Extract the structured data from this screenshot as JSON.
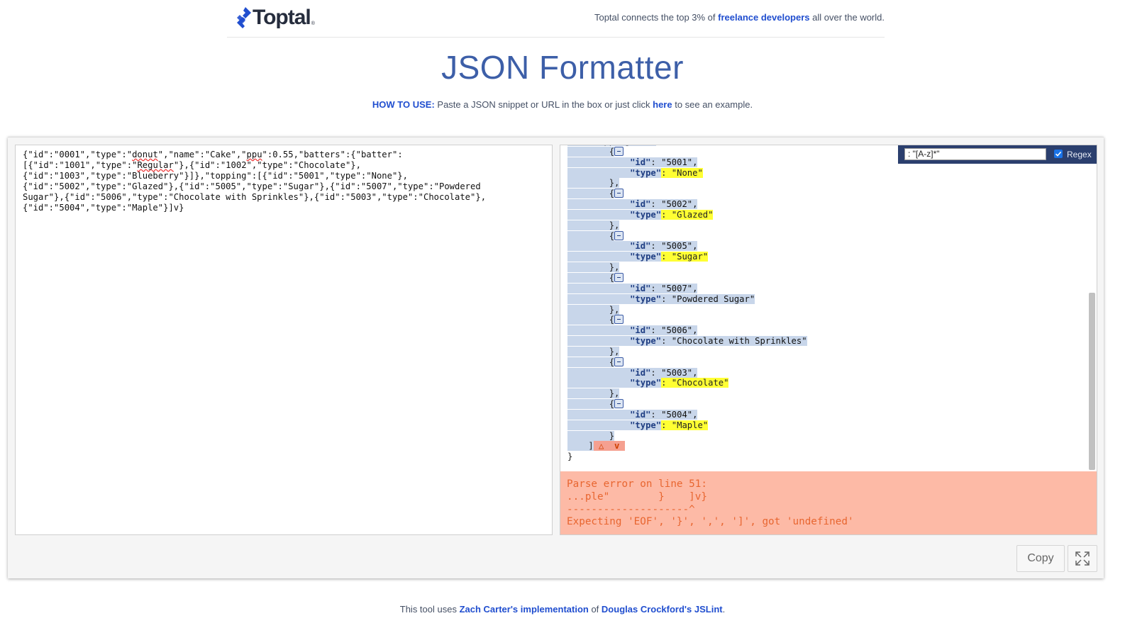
{
  "header": {
    "logo_text": "Toptal",
    "logo_reg": "®",
    "tagline_prefix": "Toptal connects the top 3% of ",
    "tagline_link": "freelance developers",
    "tagline_suffix": " all over the world."
  },
  "page_title": "JSON Formatter",
  "howto": {
    "lead": "HOW TO USE:",
    "text": " Paste a JSON snippet or URL in the box or just click ",
    "link": "here",
    "suffix": " to see an example."
  },
  "input": {
    "value_lines": [
      "{\"id\":\"0001\",\"type\":\"donut\",\"name\":\"Cake\",\"ppu\":0.55,\"batters\":{\"batter\":",
      "[{\"id\":\"1001\",\"type\":\"Regular\"},{\"id\":\"1002\",\"type\":\"Chocolate\"},",
      "{\"id\":\"1003\",\"type\":\"Blueberry\"}]},\"topping\":[{\"id\":\"5001\",\"type\":\"None\"},",
      "{\"id\":\"5002\",\"type\":\"Glazed\"},{\"id\":\"5005\",\"type\":\"Sugar\"},{\"id\":\"5007\",\"type\":\"Powdered",
      "Sugar\"},{\"id\":\"5006\",\"type\":\"Chocolate with Sprinkles\"},{\"id\":\"5003\",\"type\":\"Chocolate\"},",
      "{\"id\":\"5004\",\"type\":\"Maple\"}]v}"
    ]
  },
  "output": {
    "partial_top": "\"topping\": [",
    "items": [
      {
        "id": "\"5001\"",
        "type": "\"None\"",
        "matched": true
      },
      {
        "id": "\"5002\"",
        "type": "\"Glazed\"",
        "matched": true
      },
      {
        "id": "\"5005\"",
        "type": "\"Sugar\"",
        "matched": true
      },
      {
        "id": "\"5007\"",
        "type": "\"Powdered Sugar\"",
        "matched": false
      },
      {
        "id": "\"5006\"",
        "type": "\"Chocolate with Sprinkles\"",
        "matched": false
      },
      {
        "id": "\"5003\"",
        "type": "\"Chocolate\"",
        "matched": true
      },
      {
        "id": "\"5004\"",
        "type": "\"Maple\"",
        "matched": true
      }
    ],
    "id_key": "\"id\"",
    "type_key": "\"type\"",
    "open_brace": "{",
    "close_brace_comma": "},",
    "close_brace": "}",
    "array_close": "]",
    "error_marker": "v",
    "final_brace": "}"
  },
  "search": {
    "value": ": \"[A-z]*\"",
    "regex_label": "Regex",
    "regex_checked": true
  },
  "error": {
    "lines": [
      "Parse error on line 51:",
      "...ple\"        }    ]v}",
      "--------------------^",
      "Expecting 'EOF', '}', ',', ']', got 'undefined'"
    ]
  },
  "buttons": {
    "copy": "Copy"
  },
  "footer": {
    "prefix": "This tool uses ",
    "link1": "Zach Carter's implementation",
    "middle": " of ",
    "link2": "Douglas Crockford's JSLint",
    "suffix": "."
  },
  "colors": {
    "accent": "#204ecf",
    "title": "#3d5fa8",
    "match_highlight": "#ffff33",
    "error_bg": "#fdbaa6",
    "error_text": "#e86630",
    "selection": "#c8d6ea"
  }
}
